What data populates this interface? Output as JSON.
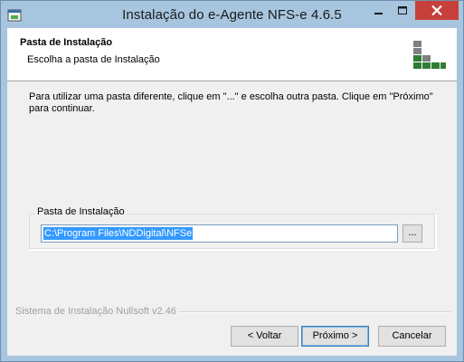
{
  "window": {
    "title": "Instalação do e-Agente NFS-e 4.6.5"
  },
  "titlebar_buttons": {
    "minimize": "minimize-icon",
    "maximize": "maximize-icon",
    "close": "close-icon"
  },
  "header": {
    "title": "Pasta de Instalação",
    "subtitle": "Escolha a pasta de Instalação",
    "logo_colors": [
      "#2e7d32",
      "#808080"
    ]
  },
  "instructions": "Para utilizar uma pasta diferente, clique em \"...\" e escolha outra pasta. Clique em \"Próximo\" para continuar.",
  "install_folder": {
    "group_label": "Pasta de Instalação",
    "value": "C:\\Program Files\\NDDigital\\NFSe",
    "browse_label": "..."
  },
  "branding": "Sistema de Instalação Nullsoft v2.46",
  "buttons": {
    "back": "< Voltar",
    "next": "Próximo >",
    "cancel": "Cancelar"
  }
}
